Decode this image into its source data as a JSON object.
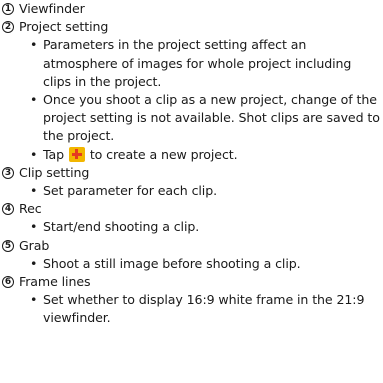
{
  "sections": [
    {
      "number": "1",
      "title": "Viewfinder",
      "bullets": []
    },
    {
      "number": "2",
      "title": "Project setting",
      "bullets": [
        "Parameters in the project setting affect an atmosphere of images for whole project including clips in the project.",
        "Once you shoot a clip as a new project, change of the project setting is not available. Shot clips are saved to the project."
      ],
      "tap_line": {
        "before": "Tap ",
        "icon": "plus-icon",
        "after": " to create a new project."
      }
    },
    {
      "number": "3",
      "title": "Clip setting",
      "bullets": [
        "Set parameter for each clip."
      ]
    },
    {
      "number": "4",
      "title": "Rec",
      "bullets": [
        "Start/end shooting a clip."
      ]
    },
    {
      "number": "5",
      "title": "Grab",
      "bullets": [
        "Shoot a still image before shooting a clip."
      ]
    },
    {
      "number": "6",
      "title": "Frame lines",
      "bullets": [
        "Set whether to display 16:9 white frame in the 21:9 viewfinder."
      ]
    }
  ],
  "colors": {
    "text": "#1a1a1a",
    "icon_background": "#f2b600",
    "icon_plus": "#e53b20"
  }
}
